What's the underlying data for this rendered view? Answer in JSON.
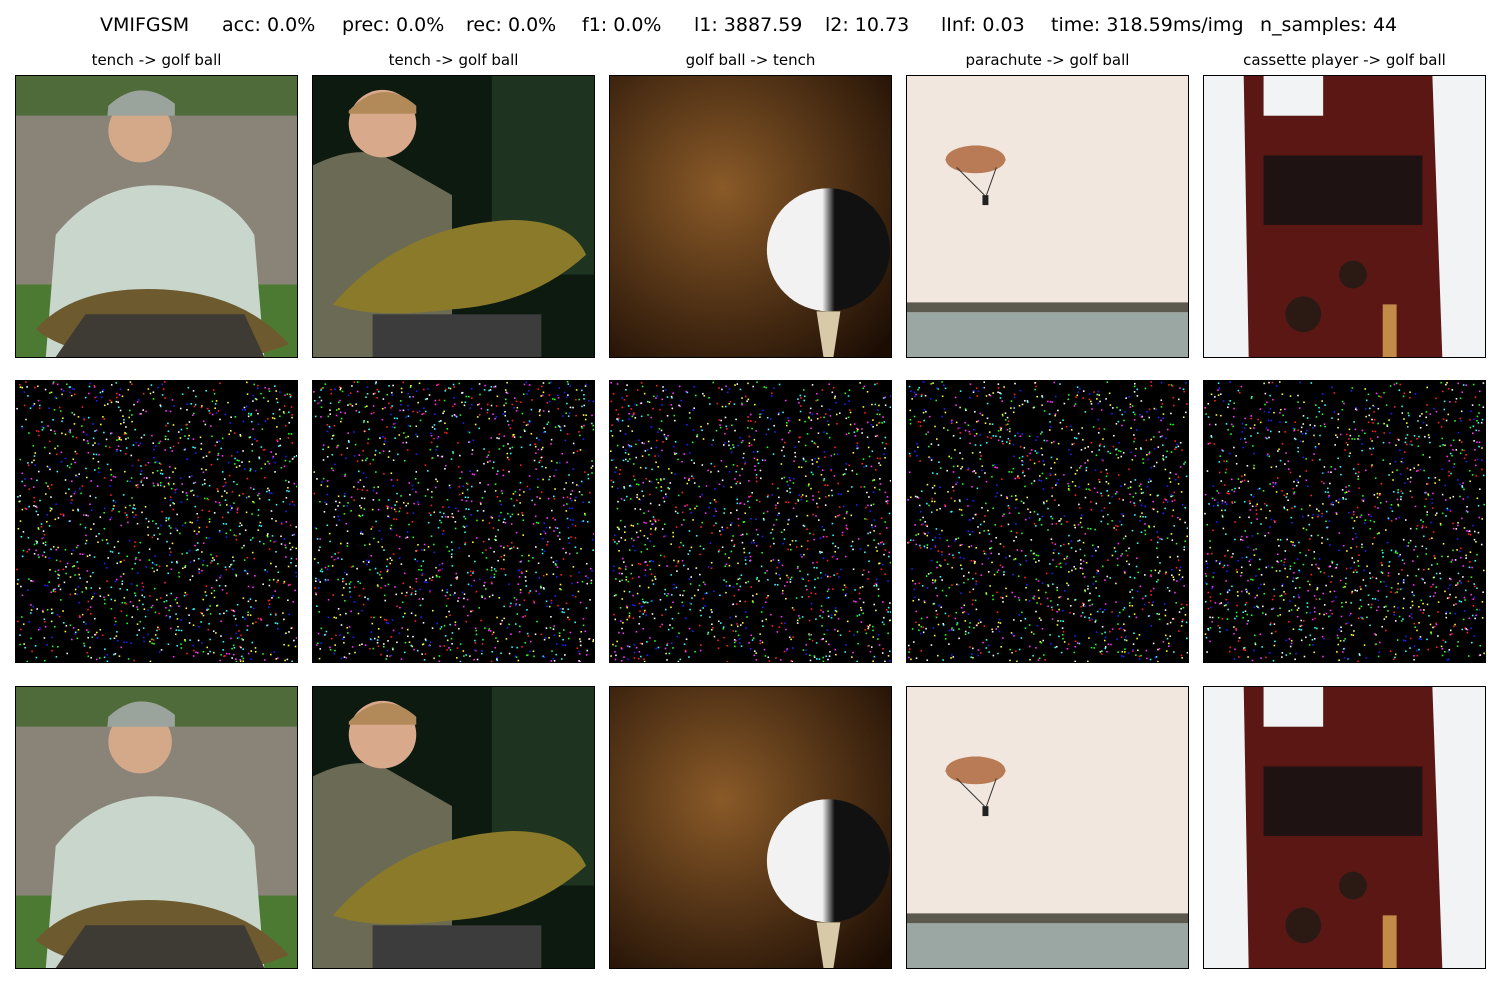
{
  "header": {
    "method": "VMIFGSM",
    "acc": "acc: 0.0%",
    "prec": "prec: 0.0%",
    "rec": "rec: 0.0%",
    "f1": "f1: 0.0%",
    "l1": "l1: 3887.59",
    "l2": "l2: 10.73",
    "linf": "lInf: 0.03",
    "time": "time: 318.59ms/img",
    "n_samples": "n_samples: 44"
  },
  "columns": [
    {
      "title": "tench -> golf ball"
    },
    {
      "title": "tench -> golf ball"
    },
    {
      "title": "golf ball -> tench"
    },
    {
      "title": "parachute -> golf ball"
    },
    {
      "title": "cassette player -> golf ball"
    }
  ]
}
